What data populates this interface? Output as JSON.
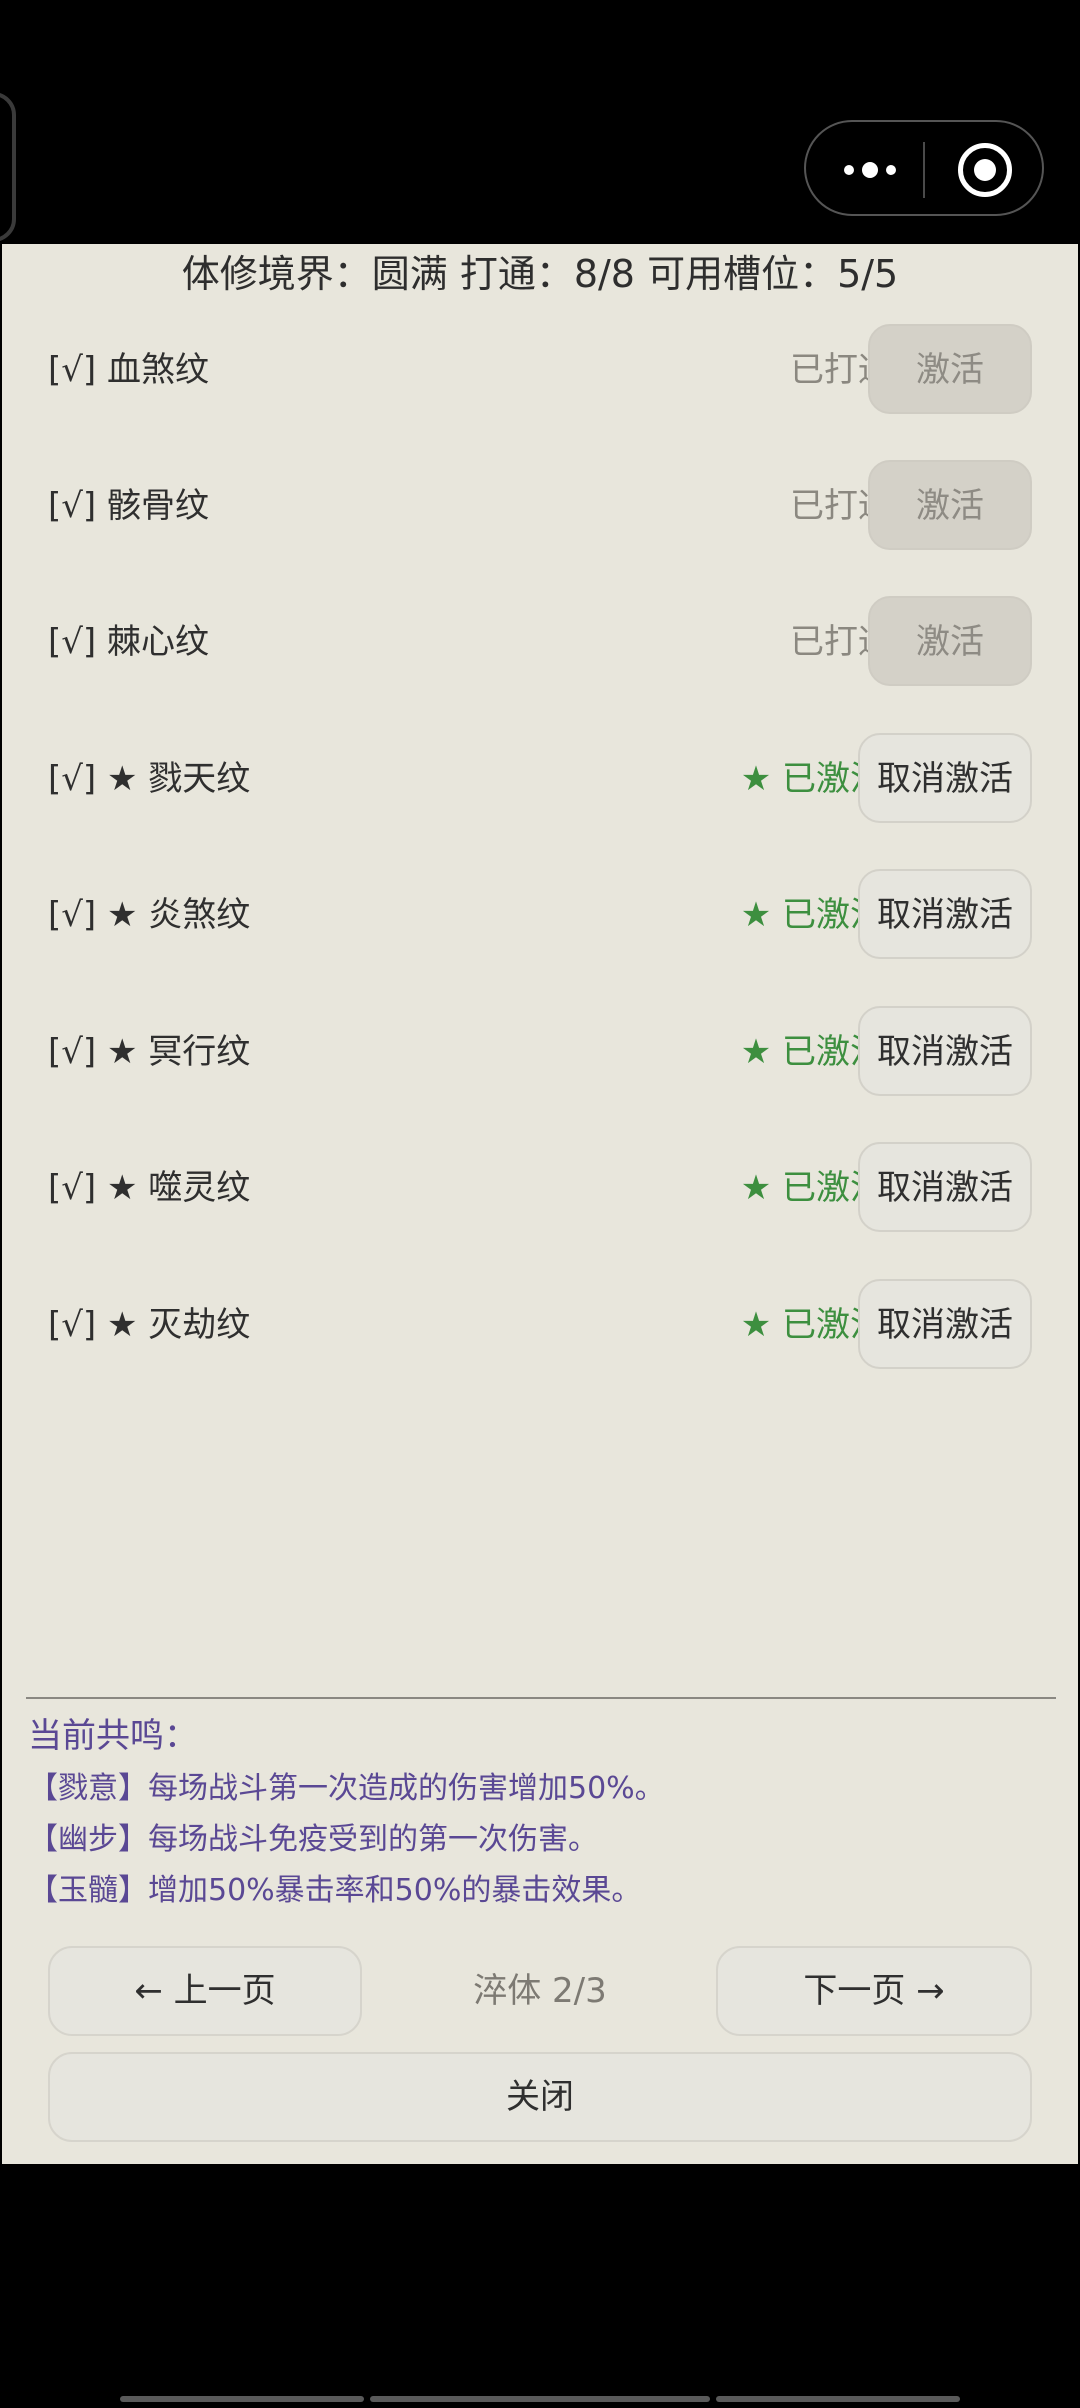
{
  "header": {
    "text": "体修境界：圆满  打通：8/8  可用槽位：5/5"
  },
  "rows": [
    {
      "name": "[√] 血煞纹",
      "status": "已打通",
      "button": "激活"
    },
    {
      "name": "[√] 骸骨纹",
      "status": "已打通",
      "button": "激活"
    },
    {
      "name": "[√] 棘心纹",
      "status": "已打通",
      "button": "激活"
    },
    {
      "name": "[√] ★ 戮天纹",
      "status": "★ 已激活",
      "button": "取消激活"
    },
    {
      "name": "[√] ★ 炎煞纹",
      "status": "★ 已激活",
      "button": "取消激活"
    },
    {
      "name": "[√] ★ 冥行纹",
      "status": "★ 已激活",
      "button": "取消激活"
    },
    {
      "name": "[√] ★ 噬灵纹",
      "status": "★ 已激活",
      "button": "取消激活"
    },
    {
      "name": "[√] ★ 灭劫纹",
      "status": "★ 已激活",
      "button": "取消激活"
    }
  ],
  "resonance": {
    "title": "当前共鸣：",
    "lines": [
      "【戮意】每场战斗第一次造成的伤害增加50%。",
      "【幽步】每场战斗免疫受到的第一次伤害。",
      "【玉髓】增加50%暴击率和50%的暴击效果。"
    ]
  },
  "nav": {
    "prev_label": "← 上一页",
    "page_label": "淬体 2/3",
    "next_label": "下一页 →",
    "close_label": "关闭"
  },
  "colors": {
    "panel_bg": "#e8e6dc",
    "active_green": "#3d8f3f",
    "resonance_purple": "#5a4894",
    "disabled_button": "#d4d1c8"
  },
  "icons": {
    "menu": "more-dots-icon",
    "close": "target-circle-icon"
  }
}
